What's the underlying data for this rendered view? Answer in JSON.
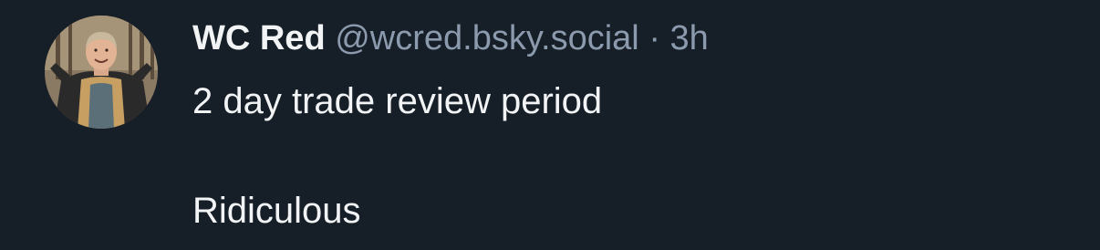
{
  "post": {
    "author": {
      "display_name": "WC Red",
      "handle": "@wcred.bsky.social",
      "avatar": "avatar-photo"
    },
    "separator": "·",
    "timestamp": "3h",
    "text_lines": [
      "2 day trade review period",
      "Ridiculous"
    ]
  },
  "colors": {
    "background": "#161e27",
    "text": "#f1f3f5",
    "muted": "#8c9aad"
  }
}
